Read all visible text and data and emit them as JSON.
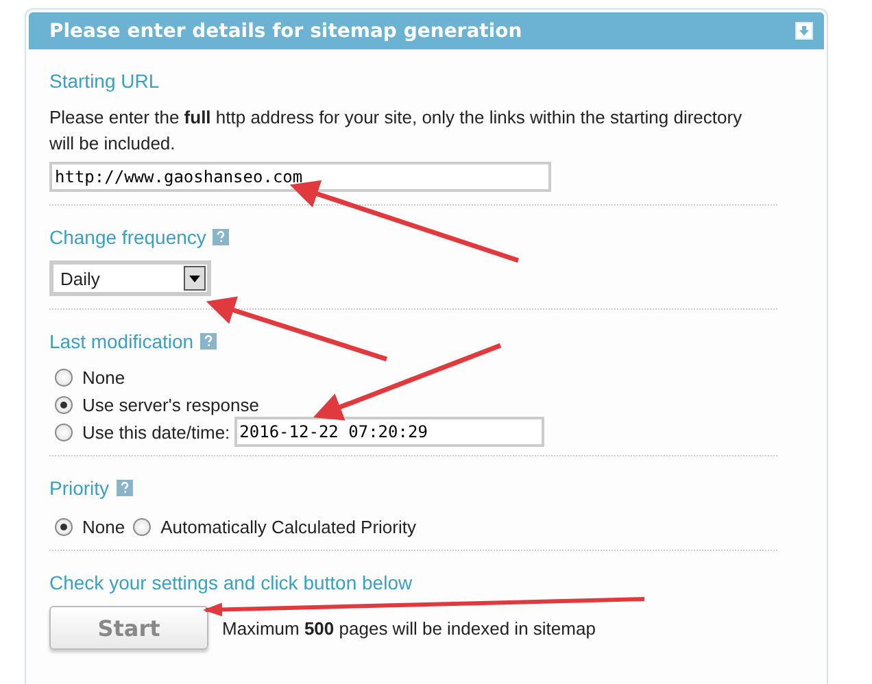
{
  "panel": {
    "title": "Please enter details for sitemap generation",
    "collapsible": true,
    "sections": [
      {
        "kind": "url",
        "heading": "Starting URL",
        "description": "Please enter the **full** http address for your site, only the links within the starting directory will be included.",
        "value": "http://www.gaoshanseo.com"
      },
      {
        "kind": "select",
        "heading": "Change frequency",
        "help": true,
        "value": "Daily"
      },
      {
        "kind": "radios",
        "heading": "Last modification",
        "help": true,
        "options": [
          {
            "label": "None",
            "selected": false
          },
          {
            "label": "Use server's response",
            "selected": true
          },
          {
            "label": "Use this date/time:",
            "selected": false,
            "value": "2016-12-22 07:20:29"
          }
        ]
      },
      {
        "kind": "radio_row",
        "heading": "Priority",
        "help": true,
        "options": [
          {
            "label": "None",
            "selected": true
          },
          {
            "label": "Automatically Calculated Priority",
            "selected": false
          }
        ]
      },
      {
        "kind": "action",
        "heading": "Check your settings and click button below",
        "button": "Start",
        "note": "Maximum **500** pages will be indexed in sitemap"
      }
    ]
  }
}
